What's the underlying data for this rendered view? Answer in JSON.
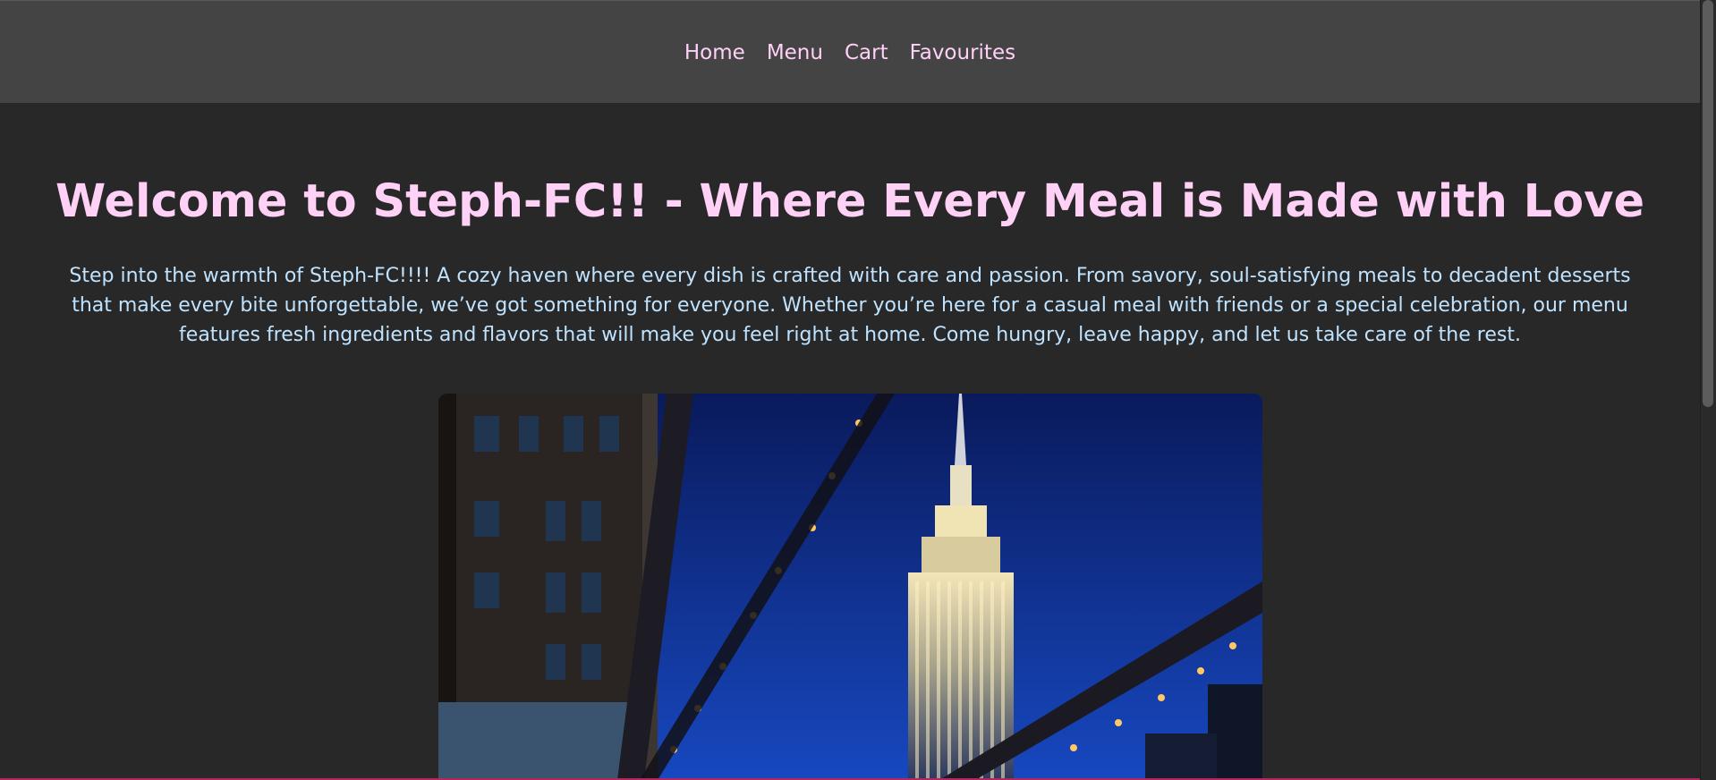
{
  "nav": {
    "items": [
      {
        "label": "Home"
      },
      {
        "label": "Menu"
      },
      {
        "label": "Cart"
      },
      {
        "label": "Favourites"
      }
    ]
  },
  "hero": {
    "title": "Welcome to Steph-FC!! - Where Every Meal is Made with Love",
    "description": "Step into the warmth of Steph-FC!!!! A cozy haven where every dish is crafted with care and passion. From savory, soul-satisfying meals to decadent desserts that make every bite unforgettable, we’ve got something for everyone. Whether you’re here for a casual meal with friends or a special celebration, our menu features fresh ingredients and flavors that will make you feel right at home. Come hungry, leave happy, and let us take care of the rest."
  },
  "colors": {
    "background": "#282828",
    "navbar": "#444444",
    "accent_pink": "#ffd1f7",
    "text_blue": "#bfe3ff"
  }
}
